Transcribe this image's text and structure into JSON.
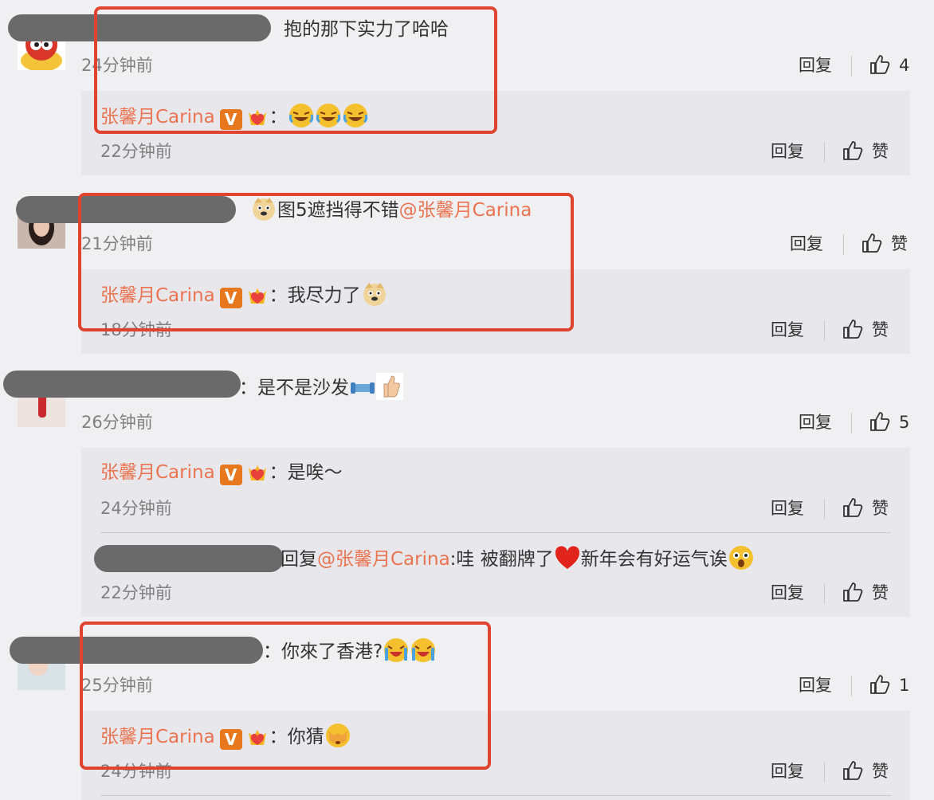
{
  "actions": {
    "reply": "回复",
    "like": "赞"
  },
  "reply_author": "张馨月Carina",
  "comments": [
    {
      "text": "抱的那下实力了哈哈",
      "time": "24分钟前",
      "likes": "4",
      "replies": [
        {
          "author": "张馨月Carina",
          "emojis": [
            "laugh-cry",
            "laugh-cry",
            "laugh-cry"
          ],
          "time": "22分钟前"
        }
      ]
    },
    {
      "text": "图5遮挡得不错",
      "mention": "@张馨月Carina",
      "time": "21分钟前",
      "replies": [
        {
          "author": "张馨月Carina",
          "text": "我尽力了",
          "time": "18分钟前"
        }
      ]
    },
    {
      "text": "：是不是沙发",
      "time": "26分钟前",
      "likes": "5",
      "replies": [
        {
          "author": "张馨月Carina",
          "text": "是唉～",
          "time": "24分钟前"
        },
        {
          "prefix": "回复",
          "mention": "@张馨月Carina",
          "text_a": ":哇 被翻牌了",
          "text_b": "新年会有好运气诶",
          "time": "22分钟前"
        }
      ]
    },
    {
      "text": "：你來了香港?",
      "time": "25分钟前",
      "likes": "1",
      "replies": [
        {
          "author": "张馨月Carina",
          "text": "你猜",
          "time": "24分钟前"
        }
      ]
    }
  ],
  "colors": {
    "accent": "#eb7350",
    "highlight": "#e0432f",
    "v_badge": "#e8781e"
  }
}
